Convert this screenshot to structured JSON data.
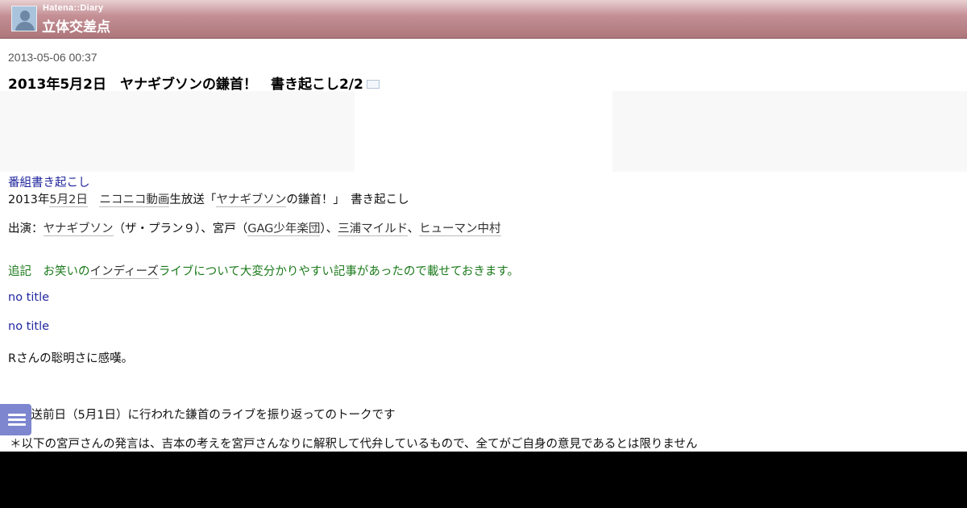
{
  "header": {
    "brand": "Hatena::Diary",
    "site_title": "立体交差点"
  },
  "entry": {
    "datetime": "2013-05-06 00:37",
    "title": "2013年5月2日　ヤナギブソンの鎌首！　書き起こし2/2",
    "category": "番組書き起こし",
    "line1": {
      "pre": "2013年",
      "date_link": "5月2日",
      "sp": "　",
      "nico": "ニコニコ動画",
      "live": "生放送「",
      "yanagi": "ヤナギブソン",
      "post": "の鎌首！」　書き起こし"
    },
    "cast": {
      "label": "出演：",
      "yanagi": "ヤナギブソン",
      "p1": "（ザ・プラン９）、宮戸（",
      "gag": "GAG少年楽団",
      "p2": "）、",
      "miura": "三浦マイルド",
      "sep": "、",
      "human": "ヒューマン中村"
    },
    "postscript": {
      "a": "追記　お笑いの",
      "indies": "インディーズ",
      "b": "ライブについて大変分かりやすい記事があったので載せておきます。"
    },
    "link1": "no title",
    "link2": "no title",
    "comment": "Rさんの聡明さに感嘆。",
    "para1": "放送前日（5月1日）に行われた鎌首のライブを振り返ってのトークです",
    "note": "＊以下の宮戸さんの発言は、吉本の考えを宮戸さんなりに解釈して代弁しているもので、全てがご自身の意見であるとは限りません"
  },
  "icons": {
    "avatar": "user-avatar-icon",
    "trackback": "trackback-icon",
    "menu": "hamburger-menu-icon"
  },
  "colors": {
    "header_gradient_top": "#e9d0d2",
    "header_gradient_bottom": "#ad767b",
    "link_blue": "#22279e",
    "postscript_green": "#1b7a1b",
    "menu_button": "#7d86cf"
  }
}
